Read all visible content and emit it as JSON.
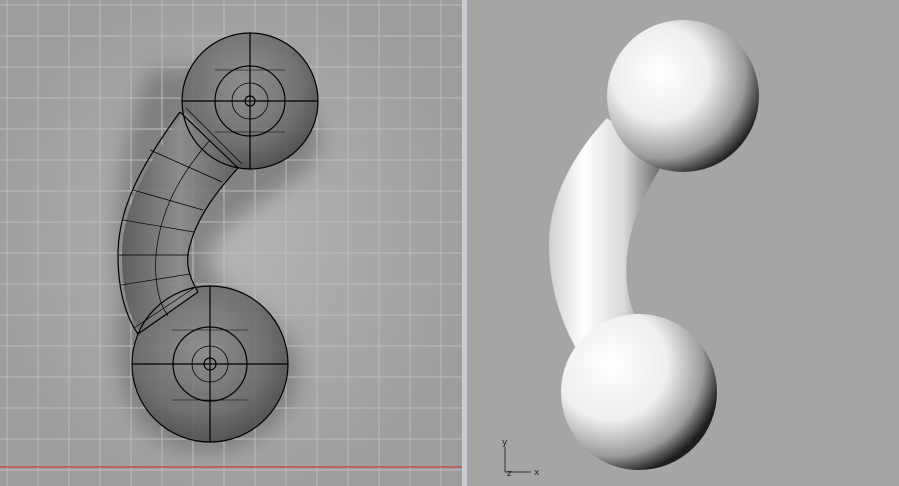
{
  "viewports": {
    "top": {
      "kind": "wireframe-with-background-reference"
    },
    "perspective": {
      "kind": "shaded"
    }
  },
  "axis_indicator": {
    "y": "y",
    "z": "z",
    "x": "x"
  },
  "colors": {
    "viewport_bg": "#a9a9a9",
    "divider": "#c9ccd2",
    "grid": "#b8b8b8",
    "x_axis_line": "#c0504d",
    "wire": "#000000"
  }
}
